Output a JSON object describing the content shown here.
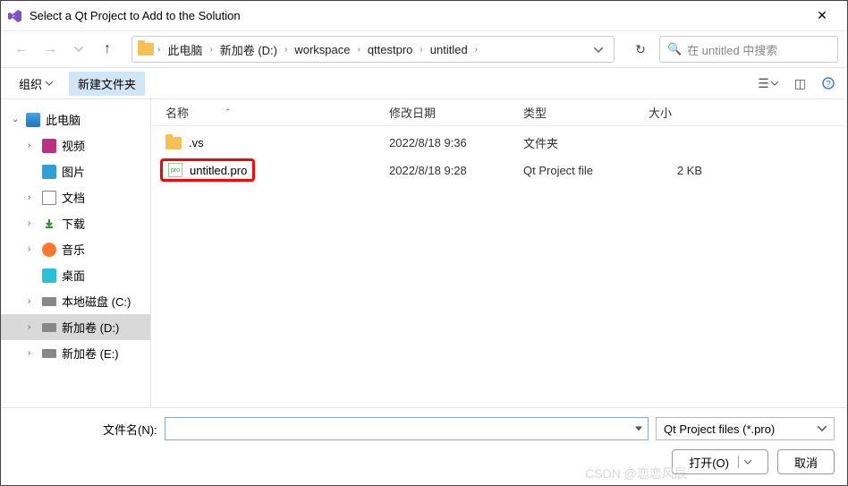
{
  "titlebar": {
    "title": "Select a Qt Project to Add to the Solution"
  },
  "breadcrumbs": {
    "items": [
      "此电脑",
      "新加卷 (D:)",
      "workspace",
      "qttestpro",
      "untitled"
    ]
  },
  "search": {
    "placeholder": "在 untitled 中搜索"
  },
  "toolbar": {
    "organize": "组织",
    "newfolder": "新建文件夹"
  },
  "sidebar": {
    "root": "此电脑",
    "items": [
      {
        "label": "视频",
        "icon": "video"
      },
      {
        "label": "图片",
        "icon": "pic"
      },
      {
        "label": "文档",
        "icon": "doc"
      },
      {
        "label": "下载",
        "icon": "download"
      },
      {
        "label": "音乐",
        "icon": "music"
      },
      {
        "label": "桌面",
        "icon": "desktop"
      },
      {
        "label": "本地磁盘 (C:)",
        "icon": "disk"
      },
      {
        "label": "新加卷 (D:)",
        "icon": "disk",
        "selected": true
      },
      {
        "label": "新加卷 (E:)",
        "icon": "disk"
      }
    ]
  },
  "columns": {
    "name": "名称",
    "date": "修改日期",
    "type": "类型",
    "size": "大小"
  },
  "files": [
    {
      "name": ".vs",
      "date": "2022/8/18 9:36",
      "type": "文件夹",
      "size": "",
      "icon": "folder"
    },
    {
      "name": "untitled.pro",
      "date": "2022/8/18 9:28",
      "type": "Qt Project file",
      "size": "2 KB",
      "icon": "pro",
      "highlighted": true
    }
  ],
  "footer": {
    "filename_label": "文件名(N):",
    "filename_value": "",
    "filter": "Qt Project files (*.pro)",
    "open": "打开(O)",
    "cancel": "取消"
  },
  "watermark": "CSDN @恋恋风辰"
}
